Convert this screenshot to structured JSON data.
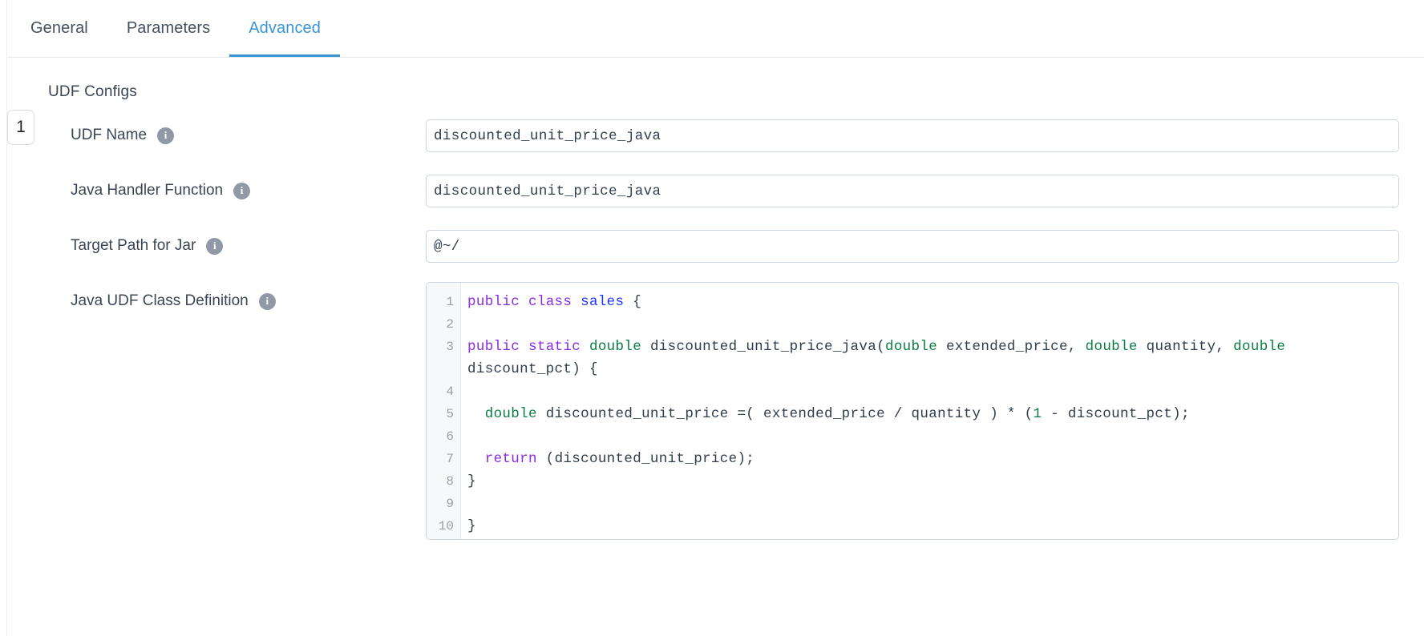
{
  "tabs": [
    {
      "label": "General",
      "active": false
    },
    {
      "label": "Parameters",
      "active": false
    },
    {
      "label": "Advanced",
      "active": true
    }
  ],
  "section": {
    "title": "UDF Configs",
    "step_number": "1"
  },
  "icons": {
    "info": "i"
  },
  "fields": [
    {
      "label": "UDF Name",
      "info_icon": "info-icon",
      "value": "discounted_unit_price_java",
      "placeholder": ""
    },
    {
      "label": "Java Handler Function",
      "info_icon": "info-icon",
      "value": "discounted_unit_price_java",
      "placeholder": ""
    },
    {
      "label": "Target Path for Jar",
      "info_icon": "info-icon",
      "value": "@~/",
      "placeholder": ""
    }
  ],
  "code_field": {
    "label": "Java UDF Class Definition",
    "info_icon": "info-icon",
    "language": "java",
    "line_numbers": [
      "1",
      "2",
      "3",
      "4",
      "5",
      "6",
      "7",
      "8",
      "9",
      "10"
    ],
    "lines": [
      "public class sales {",
      "",
      "public static double discounted_unit_price_java(double extended_price, double quantity, double discount_pct) {",
      "",
      "  double discounted_unit_price =( extended_price / quantity ) * (1 - discount_pct);",
      "",
      "  return (discounted_unit_price);",
      "}",
      "",
      "}"
    ]
  },
  "colors": {
    "accent": "#3a93d4",
    "keyword": "#8a2be2",
    "type": "#0a7d45",
    "class_name": "#1a35ff",
    "text": "#2f3d4d",
    "border": "#ccd5de",
    "info_bg": "#9099a5"
  }
}
